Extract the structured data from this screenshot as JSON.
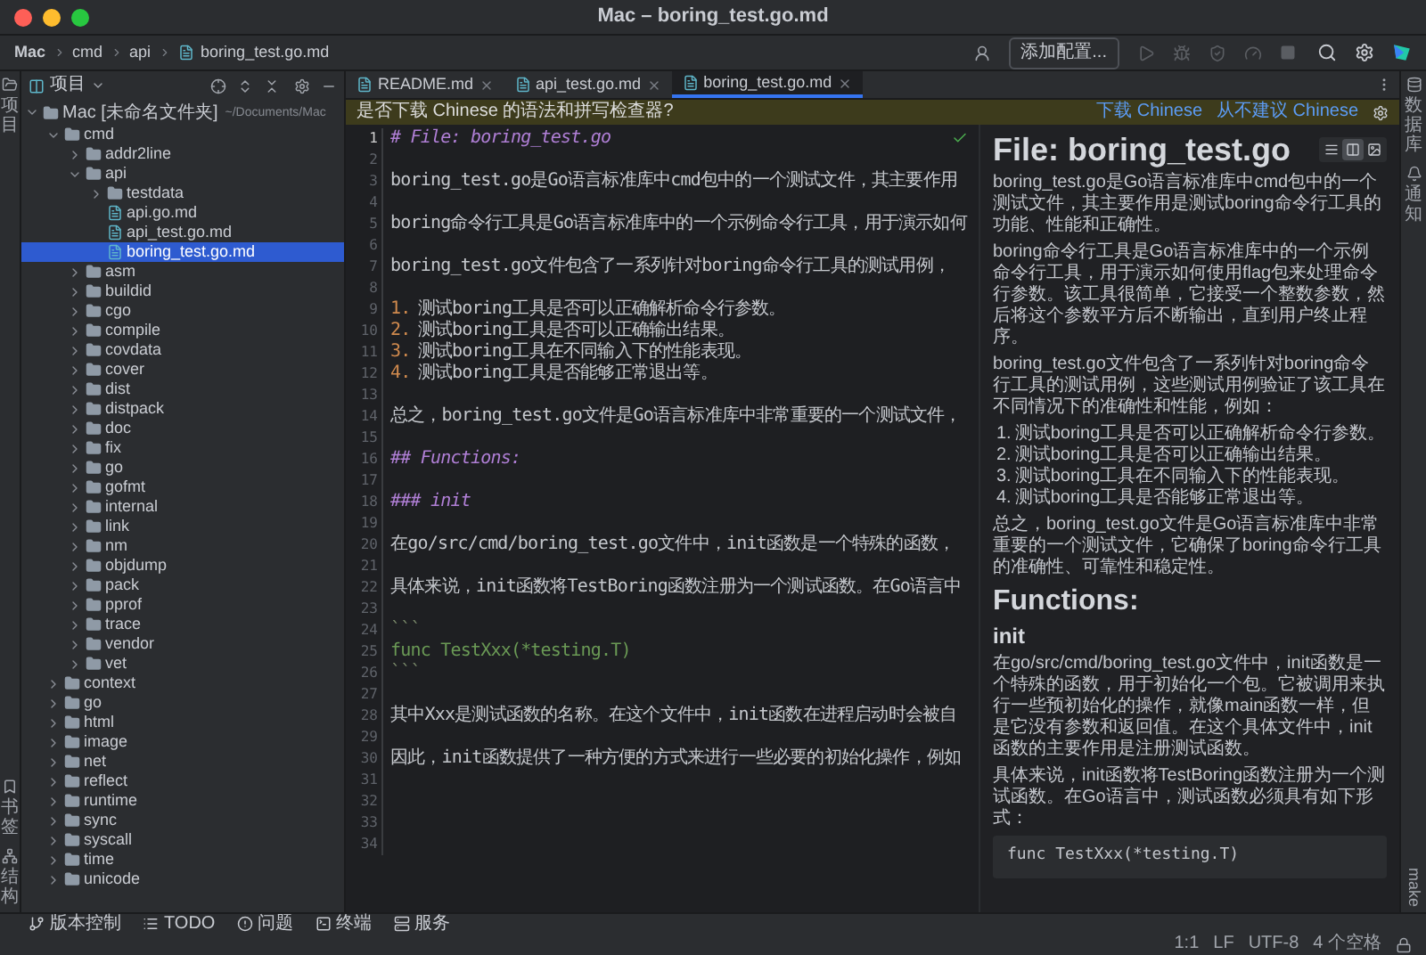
{
  "window": {
    "title": "Mac – boring_test.go.md"
  },
  "toolbar": {
    "breadcrumbs": [
      {
        "text": "Mac",
        "kind": "folder"
      },
      {
        "text": "cmd",
        "kind": "folder"
      },
      {
        "text": "api",
        "kind": "folder"
      },
      {
        "text": "boring_test.go.md",
        "kind": "file"
      }
    ],
    "run_config": "添加配置..."
  },
  "left_stripe": {
    "top": [
      {
        "label": "项目",
        "kind": "project"
      }
    ],
    "bottom": [
      {
        "label": "书签",
        "kind": "bookmark"
      },
      {
        "label": "结构",
        "kind": "structure"
      }
    ]
  },
  "project": {
    "title": "项目",
    "tree": [
      {
        "name": "Mac [未命名文件夹]",
        "path": "~/Documents/Mac",
        "kind": "folder",
        "expanded": true,
        "selected": false,
        "children": [
          {
            "name": "cmd",
            "kind": "folder",
            "expanded": true,
            "selected": false,
            "children": [
              {
                "name": "addr2line",
                "kind": "folder",
                "expanded": false,
                "selected": false
              },
              {
                "name": "api",
                "kind": "folder",
                "expanded": true,
                "selected": false,
                "children": [
                  {
                    "name": "testdata",
                    "kind": "folder",
                    "expanded": false,
                    "selected": false
                  },
                  {
                    "name": "api.go.md",
                    "kind": "file",
                    "selected": false
                  },
                  {
                    "name": "api_test.go.md",
                    "kind": "file",
                    "selected": false
                  },
                  {
                    "name": "boring_test.go.md",
                    "kind": "file",
                    "selected": true
                  }
                ]
              },
              {
                "name": "asm",
                "kind": "folder",
                "expanded": false,
                "selected": false
              },
              {
                "name": "buildid",
                "kind": "folder",
                "expanded": false,
                "selected": false
              },
              {
                "name": "cgo",
                "kind": "folder",
                "expanded": false,
                "selected": false
              },
              {
                "name": "compile",
                "kind": "folder",
                "expanded": false,
                "selected": false
              },
              {
                "name": "covdata",
                "kind": "folder",
                "expanded": false,
                "selected": false
              },
              {
                "name": "cover",
                "kind": "folder",
                "expanded": false,
                "selected": false
              },
              {
                "name": "dist",
                "kind": "folder",
                "expanded": false,
                "selected": false
              },
              {
                "name": "distpack",
                "kind": "folder",
                "expanded": false,
                "selected": false
              },
              {
                "name": "doc",
                "kind": "folder",
                "expanded": false,
                "selected": false
              },
              {
                "name": "fix",
                "kind": "folder",
                "expanded": false,
                "selected": false
              },
              {
                "name": "go",
                "kind": "folder",
                "expanded": false,
                "selected": false
              },
              {
                "name": "gofmt",
                "kind": "folder",
                "expanded": false,
                "selected": false
              },
              {
                "name": "internal",
                "kind": "folder",
                "expanded": false,
                "selected": false
              },
              {
                "name": "link",
                "kind": "folder",
                "expanded": false,
                "selected": false
              },
              {
                "name": "nm",
                "kind": "folder",
                "expanded": false,
                "selected": false
              },
              {
                "name": "objdump",
                "kind": "folder",
                "expanded": false,
                "selected": false
              },
              {
                "name": "pack",
                "kind": "folder",
                "expanded": false,
                "selected": false
              },
              {
                "name": "pprof",
                "kind": "folder",
                "expanded": false,
                "selected": false
              },
              {
                "name": "trace",
                "kind": "folder",
                "expanded": false,
                "selected": false
              },
              {
                "name": "vendor",
                "kind": "folder",
                "expanded": false,
                "selected": false
              },
              {
                "name": "vet",
                "kind": "folder",
                "expanded": false,
                "selected": false
              }
            ]
          },
          {
            "name": "context",
            "kind": "folder",
            "expanded": false,
            "selected": false
          },
          {
            "name": "go",
            "kind": "folder",
            "expanded": false,
            "selected": false
          },
          {
            "name": "html",
            "kind": "folder",
            "expanded": false,
            "selected": false
          },
          {
            "name": "image",
            "kind": "folder",
            "expanded": false,
            "selected": false
          },
          {
            "name": "net",
            "kind": "folder",
            "expanded": false,
            "selected": false
          },
          {
            "name": "reflect",
            "kind": "folder",
            "expanded": false,
            "selected": false
          },
          {
            "name": "runtime",
            "kind": "folder",
            "expanded": false,
            "selected": false
          },
          {
            "name": "sync",
            "kind": "folder",
            "expanded": false,
            "selected": false
          },
          {
            "name": "syscall",
            "kind": "folder",
            "expanded": false,
            "selected": false
          },
          {
            "name": "time",
            "kind": "folder",
            "expanded": false,
            "selected": false
          },
          {
            "name": "unicode",
            "kind": "folder",
            "expanded": false,
            "selected": false
          }
        ]
      }
    ]
  },
  "tabs": [
    {
      "label": "README.md",
      "selected": false
    },
    {
      "label": "api_test.go.md",
      "selected": false
    },
    {
      "label": "boring_test.go.md",
      "selected": true
    }
  ],
  "banner": {
    "text": "是否下载 Chinese 的语法和拼写检查器?",
    "actions": [
      "下载 Chinese",
      "从不建议 Chinese"
    ]
  },
  "editor": {
    "lines": [
      {
        "number": "1",
        "kind": "heading",
        "text": "# File: boring_test.go"
      },
      {
        "number": "2",
        "kind": "blank"
      },
      {
        "number": "3",
        "kind": "text",
        "text": "boring_test.go是Go语言标准库中cmd包中的一个测试文件，其主要作用"
      },
      {
        "number": "4",
        "kind": "blank"
      },
      {
        "number": "5",
        "kind": "text",
        "text": "boring命令行工具是Go语言标准库中的一个示例命令行工具，用于演示如何"
      },
      {
        "number": "6",
        "kind": "blank"
      },
      {
        "number": "7",
        "kind": "text",
        "text": "boring_test.go文件包含了一系列针对boring命令行工具的测试用例，"
      },
      {
        "number": "8",
        "kind": "blank"
      },
      {
        "number": "9",
        "kind": "list",
        "marker": "1.",
        "text": "测试boring工具是否可以正确解析命令行参数。"
      },
      {
        "number": "10",
        "kind": "list",
        "marker": "2.",
        "text": "测试boring工具是否可以正确输出结果。"
      },
      {
        "number": "11",
        "kind": "list",
        "marker": "3.",
        "text": "测试boring工具在不同输入下的性能表现。"
      },
      {
        "number": "12",
        "kind": "list",
        "marker": "4.",
        "text": "测试boring工具是否能够正常退出等。"
      },
      {
        "number": "13",
        "kind": "blank"
      },
      {
        "number": "14",
        "kind": "text",
        "text": "总之，boring_test.go文件是Go语言标准库中非常重要的一个测试文件，"
      },
      {
        "number": "15",
        "kind": "blank"
      },
      {
        "number": "16",
        "kind": "heading",
        "text": "## Functions:"
      },
      {
        "number": "17",
        "kind": "blank"
      },
      {
        "number": "18",
        "kind": "heading",
        "text": "### init"
      },
      {
        "number": "19",
        "kind": "blank"
      },
      {
        "number": "20",
        "kind": "text",
        "text": "在go/src/cmd/boring_test.go文件中，init函数是一个特殊的函数，"
      },
      {
        "number": "21",
        "kind": "blank"
      },
      {
        "number": "22",
        "kind": "text",
        "text": "具体来说，init函数将TestBoring函数注册为一个测试函数。在Go语言中"
      },
      {
        "number": "23",
        "kind": "blank"
      },
      {
        "number": "24",
        "kind": "fence",
        "text": "```"
      },
      {
        "number": "25",
        "kind": "code",
        "text": "func TestXxx(*testing.T)"
      },
      {
        "number": "26",
        "kind": "fence",
        "text": "```"
      },
      {
        "number": "27",
        "kind": "blank"
      },
      {
        "number": "28",
        "kind": "text",
        "text": "其中Xxx是测试函数的名称。在这个文件中，init函数在进程启动时会被自"
      },
      {
        "number": "29",
        "kind": "blank"
      },
      {
        "number": "30",
        "kind": "text",
        "text": "因此，init函数提供了一种方便的方式来进行一些必要的初始化操作，例如"
      },
      {
        "number": "31",
        "kind": "blank"
      },
      {
        "number": "32",
        "kind": "blank"
      },
      {
        "number": "33",
        "kind": "blank"
      },
      {
        "number": "34",
        "kind": "blank"
      }
    ]
  },
  "preview": {
    "view_modes": [
      {
        "kind": "editor",
        "selected": false
      },
      {
        "kind": "split",
        "selected": true
      },
      {
        "kind": "preview",
        "selected": false
      }
    ],
    "blocks": [
      {
        "kind": "h1",
        "text": "File: boring_test.go"
      },
      {
        "kind": "p",
        "text": "boring_test.go是Go语言标准库中cmd包中的一个测试文件，其主要作用是测试boring命令行工具的功能、性能和正确性。"
      },
      {
        "kind": "p",
        "text": "boring命令行工具是Go语言标准库中的一个示例命令行工具，用于演示如何使用flag包来处理命令行参数。该工具很简单，它接受一个整数参数，然后将这个参数平方后不断输出，直到用户终止程序。"
      },
      {
        "kind": "p",
        "text": "boring_test.go文件包含了一系列针对boring命令行工具的测试用例，这些测试用例验证了该工具在不同情况下的准确性和性能，例如："
      },
      {
        "kind": "ol",
        "items": [
          {
            "marker": "1.",
            "text": "测试boring工具是否可以正确解析命令行参数。"
          },
          {
            "marker": "2.",
            "text": "测试boring工具是否可以正确输出结果。"
          },
          {
            "marker": "3.",
            "text": "测试boring工具在不同输入下的性能表现。"
          },
          {
            "marker": "4.",
            "text": "测试boring工具是否能够正常退出等。"
          }
        ]
      },
      {
        "kind": "p",
        "text": "总之，boring_test.go文件是Go语言标准库中非常重要的一个测试文件，它确保了boring命令行工具的准确性、可靠性和稳定性。"
      },
      {
        "kind": "h2",
        "text": "Functions:"
      },
      {
        "kind": "h3",
        "text": "init"
      },
      {
        "kind": "p",
        "text": "在go/src/cmd/boring_test.go文件中，init函数是一个特殊的函数，用于初始化一个包。它被调用来执行一些预初始化的操作，就像main函数一样，但是它没有参数和返回值。在这个具体文件中，init函数的主要作用是注册测试函数。"
      },
      {
        "kind": "p",
        "text": "具体来说，init函数将TestBoring函数注册为一个测试函数。在Go语言中，测试函数必须具有如下形式："
      },
      {
        "kind": "code",
        "text": "func TestXxx(*testing.T)"
      }
    ]
  },
  "right_stripe": {
    "top": [
      {
        "label": "数据库",
        "kind": "database"
      },
      {
        "label": "通知",
        "kind": "bell"
      }
    ],
    "bottom": [
      {
        "label": "make",
        "kind": "make"
      }
    ]
  },
  "tool_windows": [
    {
      "label": "版本控制",
      "kind": "vcs"
    },
    {
      "label": "TODO",
      "kind": "todo"
    },
    {
      "label": "问题",
      "kind": "problems"
    },
    {
      "label": "终端",
      "kind": "terminal"
    },
    {
      "label": "服务",
      "kind": "services"
    }
  ],
  "status_bar": [
    "1:1",
    "LF",
    "UTF-8",
    "4 个空格"
  ]
}
